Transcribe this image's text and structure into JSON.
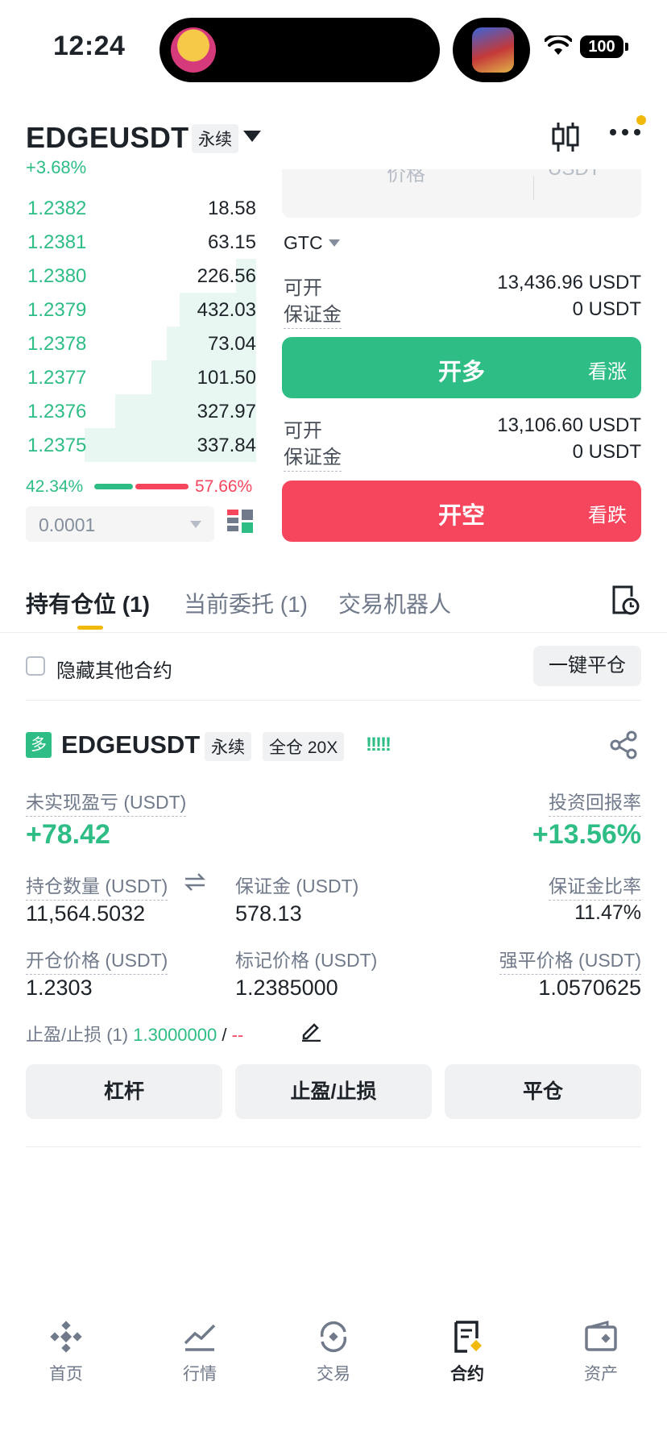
{
  "status_bar": {
    "time": "12:24",
    "battery": "100"
  },
  "header": {
    "symbol": "EDGEUSDT",
    "contract_type": "永续",
    "change": "+3.68%"
  },
  "order_book": {
    "rows": [
      {
        "price": "1.2382",
        "qty": "18.58",
        "depth": 0.0
      },
      {
        "price": "1.2381",
        "qty": "63.15",
        "depth": 0.0
      },
      {
        "price": "1.2380",
        "qty": "226.56",
        "depth": 0.08
      },
      {
        "price": "1.2379",
        "qty": "432.03",
        "depth": 0.3
      },
      {
        "price": "1.2378",
        "qty": "73.04",
        "depth": 0.35
      },
      {
        "price": "1.2377",
        "qty": "101.50",
        "depth": 0.41
      },
      {
        "price": "1.2376",
        "qty": "327.97",
        "depth": 0.55
      },
      {
        "price": "1.2375",
        "qty": "337.84",
        "depth": 0.67
      }
    ],
    "buy_ratio": "42.34%",
    "sell_ratio": "57.66%",
    "precision": "0.0001"
  },
  "order_panel": {
    "price_placeholder": "价格",
    "price_unit": "USDT",
    "time_in_force": "GTC",
    "long": {
      "avail_label": "可开",
      "avail_value": "13,436.96 USDT",
      "margin_label": "保证金",
      "margin_value": "0 USDT",
      "button": "开多",
      "button_sub": "看涨"
    },
    "short": {
      "avail_label": "可开",
      "avail_value": "13,106.60 USDT",
      "margin_label": "保证金",
      "margin_value": "0 USDT",
      "button": "开空",
      "button_sub": "看跌"
    }
  },
  "tabs": [
    "持有仓位 (1)",
    "当前委托 (1)",
    "交易机器人"
  ],
  "hide_other": "隐藏其他合约",
  "close_all": "一键平仓",
  "position": {
    "side_badge": "多",
    "symbol": "EDGEUSDT",
    "contract_type": "永续",
    "margin_mode": "全仓 20X",
    "signal": "!!!!!",
    "pnl_label": "未实现盈亏 (USDT)",
    "pnl_value": "+78.42",
    "roi_label": "投资回报率",
    "roi_value": "+13.56%",
    "size_label": "持仓数量 (USDT)",
    "size_value": "11,564.5032",
    "margin_label": "保证金 (USDT)",
    "margin_value": "578.13",
    "margin_ratio_label": "保证金比率",
    "margin_ratio_value": "11.47%",
    "entry_label": "开仓价格 (USDT)",
    "entry_value": "1.2303",
    "mark_label": "标记价格 (USDT)",
    "mark_value": "1.2385000",
    "liq_label": "强平价格 (USDT)",
    "liq_value": "1.0570625",
    "tpsl_label": "止盈/止损 (1)",
    "tp_value": "1.3000000",
    "tpsl_sep": " / ",
    "sl_value": "--",
    "btn_leverage": "杠杆",
    "btn_tpsl": "止盈/止损",
    "btn_close": "平仓"
  },
  "bottom_nav": [
    "首页",
    "行情",
    "交易",
    "合约",
    "资产"
  ],
  "colors": {
    "green": "#2ebd85",
    "red": "#f6465d",
    "yellow": "#f0b90b"
  }
}
